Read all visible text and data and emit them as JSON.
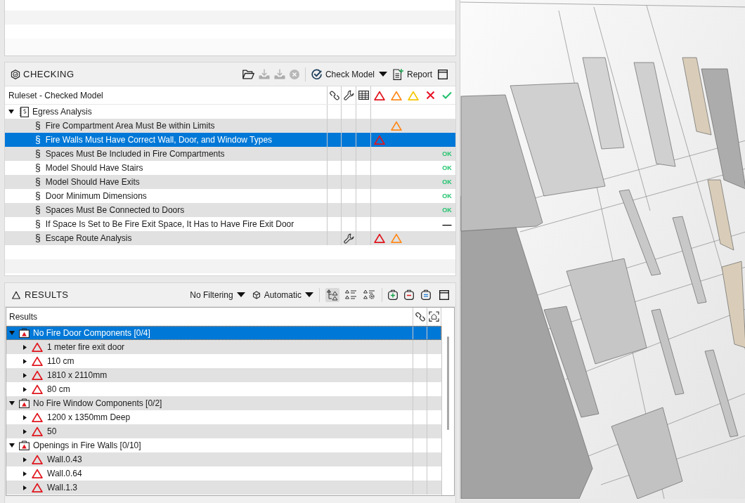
{
  "checking": {
    "title": "CHECKING",
    "toolbar": {
      "tools": [
        {
          "kind": "folder",
          "disabled": false
        },
        {
          "kind": "import",
          "disabled": true
        },
        {
          "kind": "import",
          "disabled": true
        },
        {
          "kind": "stop",
          "disabled": true
        }
      ],
      "check_button": {
        "label": "Check Model"
      },
      "report_button": {
        "label": "Report"
      }
    },
    "column_heading": "Ruleset - Checked Model",
    "rulesets": [
      {
        "label": "Egress Analysis",
        "expanded": true,
        "selected": false,
        "children": [
          {
            "symbol": "§",
            "label": "Fire Compartment Area Must Be within Limits",
            "selected": false,
            "wrench": false,
            "marks": [
              {
                "kind": "moderate"
              }
            ]
          },
          {
            "symbol": "§",
            "label": "Fire Walls Must Have Correct Wall, Door, and Window Types",
            "selected": true,
            "wrench": false,
            "marks": [
              {
                "kind": "critical"
              }
            ]
          },
          {
            "symbol": "§",
            "label": "Spaces Must Be Included in Fire Compartments",
            "selected": false,
            "wrench": false,
            "marks": [
              {
                "kind": "passed",
                "text": "OK"
              }
            ]
          },
          {
            "symbol": "§",
            "label": "Model Should Have Stairs",
            "selected": false,
            "wrench": false,
            "marks": [
              {
                "kind": "passed",
                "text": "OK"
              }
            ]
          },
          {
            "symbol": "§",
            "label": "Model Should Have Exits",
            "selected": false,
            "wrench": false,
            "marks": [
              {
                "kind": "passed",
                "text": "OK"
              }
            ]
          },
          {
            "symbol": "§",
            "label": "Door Minimum Dimensions",
            "selected": false,
            "wrench": false,
            "marks": [
              {
                "kind": "passed",
                "text": "OK"
              }
            ]
          },
          {
            "symbol": "§",
            "label": "Spaces Must Be Connected to Doors",
            "selected": false,
            "wrench": false,
            "marks": [
              {
                "kind": "passed",
                "text": "OK"
              }
            ]
          },
          {
            "symbol": "§",
            "label": "If Space Is Set to Be Fire Exit Space, It Has to Have Fire Exit Door",
            "selected": false,
            "wrench": false,
            "marks": [
              {
                "kind": "not-checked",
                "text": "—"
              }
            ]
          },
          {
            "symbol": "§",
            "label": "Escape Route Analysis",
            "selected": false,
            "wrench": true,
            "marks": [
              {
                "kind": "critical"
              },
              {
                "kind": "moderate"
              }
            ]
          }
        ]
      }
    ]
  },
  "results": {
    "title": "RESULTS",
    "filter": {
      "value": "No Filtering"
    },
    "mode": {
      "value": "Automatic"
    },
    "view_toggles": [
      {
        "kind": "tree",
        "selected": true
      },
      {
        "kind": "list",
        "selected": false
      },
      {
        "kind": "list-settings",
        "selected": false
      }
    ],
    "column_heading": "Results",
    "groups": [
      {
        "label": "No Fire Door Components [0/4]",
        "expanded": true,
        "selected": true,
        "children": [
          {
            "label": "1 meter fire exit door",
            "expanded": false,
            "selected": false
          },
          {
            "label": "110 cm",
            "expanded": false,
            "selected": false
          },
          {
            "label": "1810 x 2110mm",
            "expanded": false,
            "selected": false
          },
          {
            "label": "80 cm",
            "expanded": false,
            "selected": false
          }
        ]
      },
      {
        "label": "No Fire Window Components [0/2]",
        "expanded": true,
        "selected": false,
        "children": [
          {
            "label": "1200 x 1350mm Deep",
            "expanded": false,
            "selected": false
          },
          {
            "label": "50",
            "expanded": false,
            "selected": false
          }
        ]
      },
      {
        "label": "Openings in Fire Walls [0/10]",
        "expanded": true,
        "selected": false,
        "children": [
          {
            "label": "Wall.0.43",
            "expanded": false,
            "selected": false
          },
          {
            "label": "Wall.0.64",
            "expanded": false,
            "selected": false
          },
          {
            "label": "Wall.1.3",
            "expanded": false,
            "selected": false
          }
        ]
      }
    ]
  }
}
